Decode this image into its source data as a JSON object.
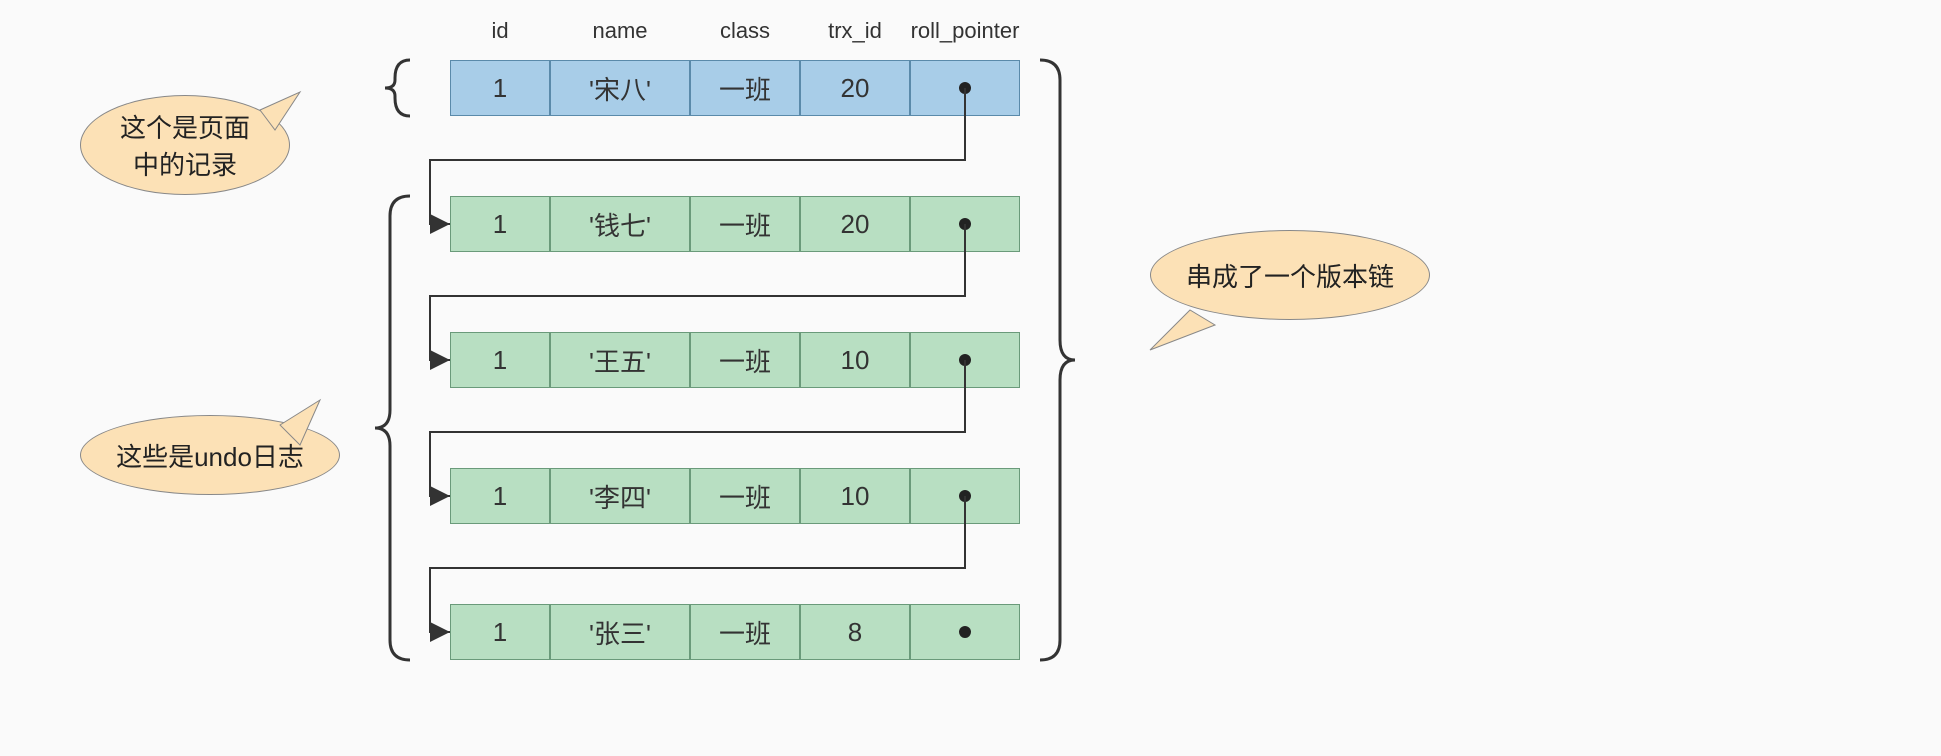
{
  "columns": [
    "id",
    "name",
    "class",
    "trx_id",
    "roll_pointer"
  ],
  "rows": [
    {
      "id": "1",
      "name": "'宋八'",
      "class": "一班",
      "trx_id": "20",
      "type": "page"
    },
    {
      "id": "1",
      "name": "'钱七'",
      "class": "一班",
      "trx_id": "20",
      "type": "undo"
    },
    {
      "id": "1",
      "name": "'王五'",
      "class": "一班",
      "trx_id": "10",
      "type": "undo"
    },
    {
      "id": "1",
      "name": "'李四'",
      "class": "一班",
      "trx_id": "10",
      "type": "undo"
    },
    {
      "id": "1",
      "name": "'张三'",
      "class": "一班",
      "trx_id": "8",
      "type": "undo"
    }
  ],
  "callouts": {
    "left_top": "这个是页面\n中的记录",
    "left_bottom": "这些是undo日志",
    "right": "串成了一个版本链"
  }
}
